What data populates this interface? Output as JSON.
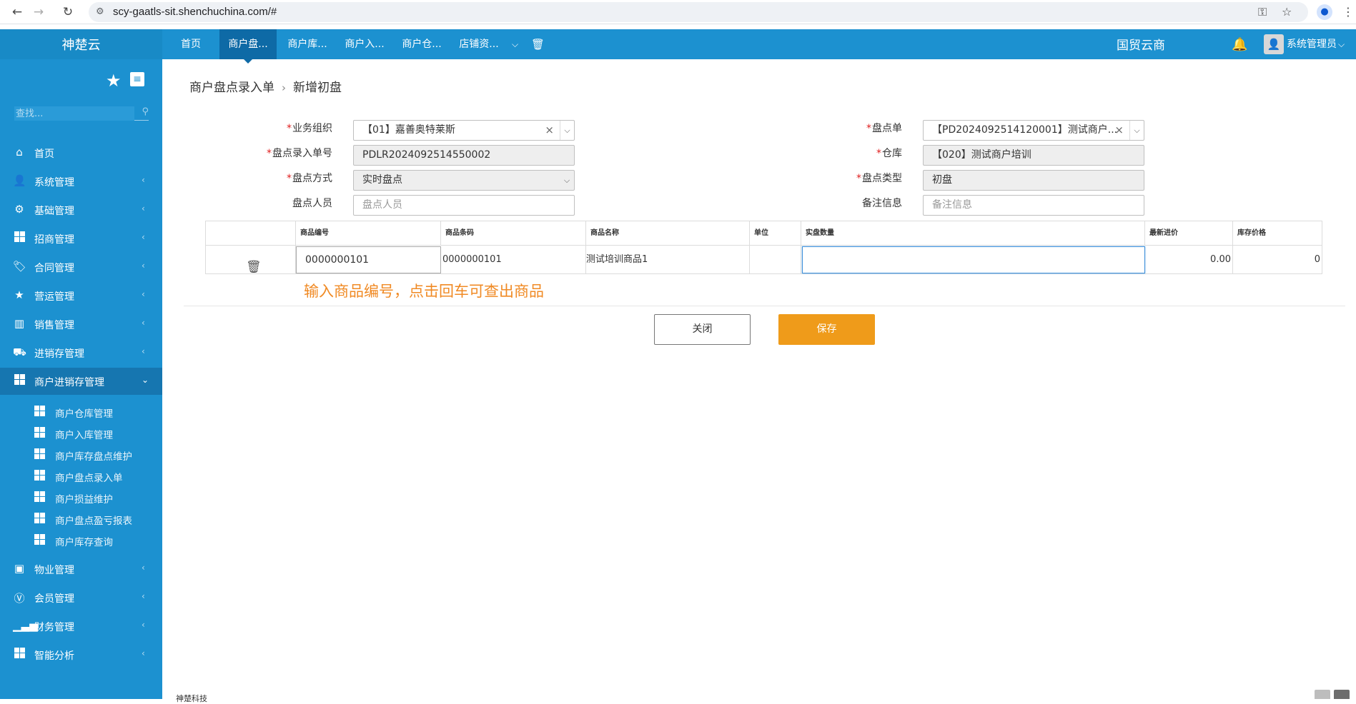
{
  "browser": {
    "url": "scy-gaatls-sit.shenchuchina.com/#"
  },
  "header": {
    "brand": "神楚云",
    "tabs": [
      {
        "label": "首页"
      },
      {
        "label": "商户盘..."
      },
      {
        "label": "商户库..."
      },
      {
        "label": "商户入..."
      },
      {
        "label": "商户仓..."
      },
      {
        "label": "店铺资..."
      }
    ],
    "company": "国贸云商",
    "user": "系统管理员"
  },
  "sidebar": {
    "search_placeholder": "查找...",
    "menu": [
      {
        "label": "首页",
        "icon": "home-icon"
      },
      {
        "label": "系统管理",
        "icon": "user-icon"
      },
      {
        "label": "基础管理",
        "icon": "gear-icon"
      },
      {
        "label": "招商管理",
        "icon": "windows-icon"
      },
      {
        "label": "合同管理",
        "icon": "tag-icon"
      },
      {
        "label": "营运管理",
        "icon": "star-icon"
      },
      {
        "label": "销售管理",
        "icon": "bar-chart-icon"
      },
      {
        "label": "进销存管理",
        "icon": "truck-icon"
      },
      {
        "label": "商户进销存管理",
        "icon": "windows-icon"
      }
    ],
    "submenu": [
      {
        "label": "商户仓库管理"
      },
      {
        "label": "商户入库管理"
      },
      {
        "label": "商户库存盘点维护"
      },
      {
        "label": "商户盘点录入单"
      },
      {
        "label": "商户损益维护"
      },
      {
        "label": "商户盘点盈亏报表"
      },
      {
        "label": "商户库存查询"
      }
    ],
    "menu_bottom": [
      {
        "label": "物业管理",
        "icon": "briefcase-icon"
      },
      {
        "label": "会员管理",
        "icon": "vimeo-icon"
      },
      {
        "label": "财务管理",
        "icon": "signal-icon"
      },
      {
        "label": "智能分析",
        "icon": "windows-icon"
      }
    ]
  },
  "breadcrumb": {
    "parent": "商户盘点录入单",
    "current": "新增初盘"
  },
  "form": {
    "org_label": "业务组织",
    "org_value": "【01】嘉善奥特莱斯",
    "entry_no_label": "盘点录入单号",
    "entry_no_value": "PDLR2024092514550002",
    "method_label": "盘点方式",
    "method_value": "实时盘点",
    "staff_label": "盘点人员",
    "staff_placeholder": "盘点人员",
    "sheet_label": "盘点单",
    "sheet_value": "【PD2024092514120001】测试商户...",
    "warehouse_label": "仓库",
    "warehouse_value": "【020】测试商户培训",
    "type_label": "盘点类型",
    "type_value": "初盘",
    "remark_label": "备注信息",
    "remark_placeholder": "备注信息"
  },
  "table": {
    "columns": [
      "商品编号",
      "商品条码",
      "商品名称",
      "单位",
      "实盘数量",
      "最新进价",
      "库存价格"
    ],
    "rows": [
      {
        "code": "0000000101",
        "barcode": "0000000101",
        "name": "测试培训商品1",
        "unit": "",
        "qty": "",
        "latest_price": "0.00",
        "stock_price": "0"
      }
    ]
  },
  "hint": "输入商品编号，点击回车可查出商品",
  "buttons": {
    "close": "关闭",
    "save": "保存"
  },
  "footer": "神楚科技"
}
